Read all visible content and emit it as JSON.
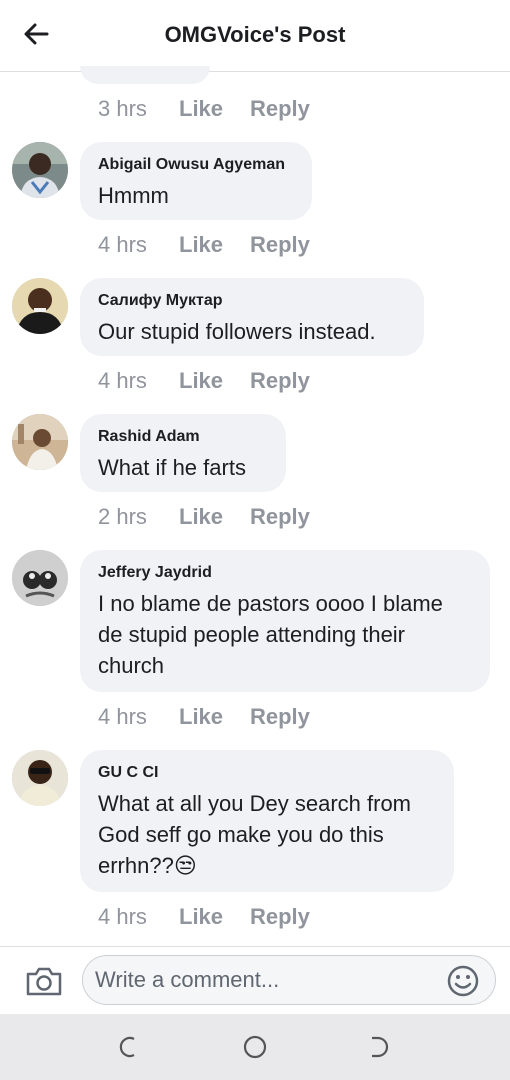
{
  "header": {
    "title": "OMGVoice's Post",
    "back_icon": "arrow-left-icon"
  },
  "comments": [
    {
      "time": "3 hrs",
      "like": "Like",
      "reply": "Reply"
    },
    {
      "author": "Abigail Owusu Agyeman",
      "text": "Hmmm",
      "time": "4 hrs",
      "like": "Like",
      "reply": "Reply"
    },
    {
      "author": "Салифу Мyктар",
      "text": "Our stupid followers instead.",
      "time": "4 hrs",
      "like": "Like",
      "reply": "Reply"
    },
    {
      "author": "Rashid Adam",
      "text": "What if he farts",
      "time": "2 hrs",
      "like": "Like",
      "reply": "Reply"
    },
    {
      "author": "Jeffery Jaydrid",
      "text": "I no blame de pastors oooo I blame\nde stupid people attending their\nchurch",
      "time": "4 hrs",
      "like": "Like",
      "reply": "Reply"
    },
    {
      "author": "GU C CI",
      "text": "What at all you Dey search from\nGod seff go make you do this\nerrhn??",
      "emoji": "😒",
      "time": "4 hrs",
      "like": "Like",
      "reply": "Reply"
    }
  ],
  "composer": {
    "placeholder": "Write a comment...",
    "camera_icon": "camera-icon",
    "emoji_icon": "smiley-icon"
  },
  "navbar": {
    "icons": [
      "recent-apps-icon",
      "home-icon",
      "back-icon"
    ]
  },
  "colors": {
    "bubble": "#f0f2f5",
    "meta": "#90949c",
    "text": "#1c1e21",
    "navbar": "#e9e9eb"
  }
}
